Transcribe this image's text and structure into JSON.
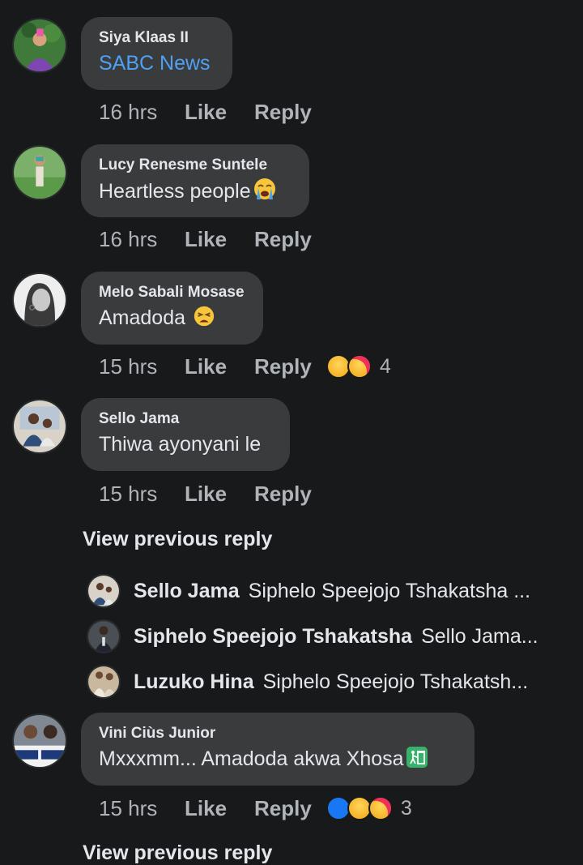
{
  "comments": [
    {
      "author": "Siya Klaas II",
      "text": "SABC News",
      "time": "16 hrs",
      "like": "Like",
      "reply": "Reply"
    },
    {
      "author": "Lucy Renesme Suntele",
      "text": "Heartless people",
      "time": "16 hrs",
      "like": "Like",
      "reply": "Reply"
    },
    {
      "author": "Melo Sabali Mosase",
      "text": "Amadoda",
      "time": "15 hrs",
      "like": "Like",
      "reply": "Reply",
      "reaction_count": "4"
    },
    {
      "author": "Sello Jama",
      "text": "Thiwa ayonyani le",
      "time": "15 hrs",
      "like": "Like",
      "reply": "Reply"
    },
    {
      "author": "Vini Ciùs Junior",
      "text": "Mxxxmm... Amadoda akwa Xhosa",
      "time": "15 hrs",
      "like": "Like",
      "reply": "Reply",
      "reaction_count": "3"
    }
  ],
  "view_previous_reply": "View previous reply",
  "view_previous_reply_2": "View previous reply",
  "replies": [
    {
      "name": "Sello Jama",
      "snippet": "Siphelo Speejojo Tshakatsha ..."
    },
    {
      "name": "Siphelo Speejojo Tshakatsha",
      "snippet": "Sello Jama..."
    },
    {
      "name": "Luzuko Hina",
      "snippet": "Siphelo Speejojo Tshakatsh..."
    }
  ],
  "colors": {
    "background": "#18191a",
    "bubble": "#3a3b3c",
    "link": "#4ea1f3",
    "meta": "#b0b3b8",
    "like_blue": "#1877f2"
  }
}
